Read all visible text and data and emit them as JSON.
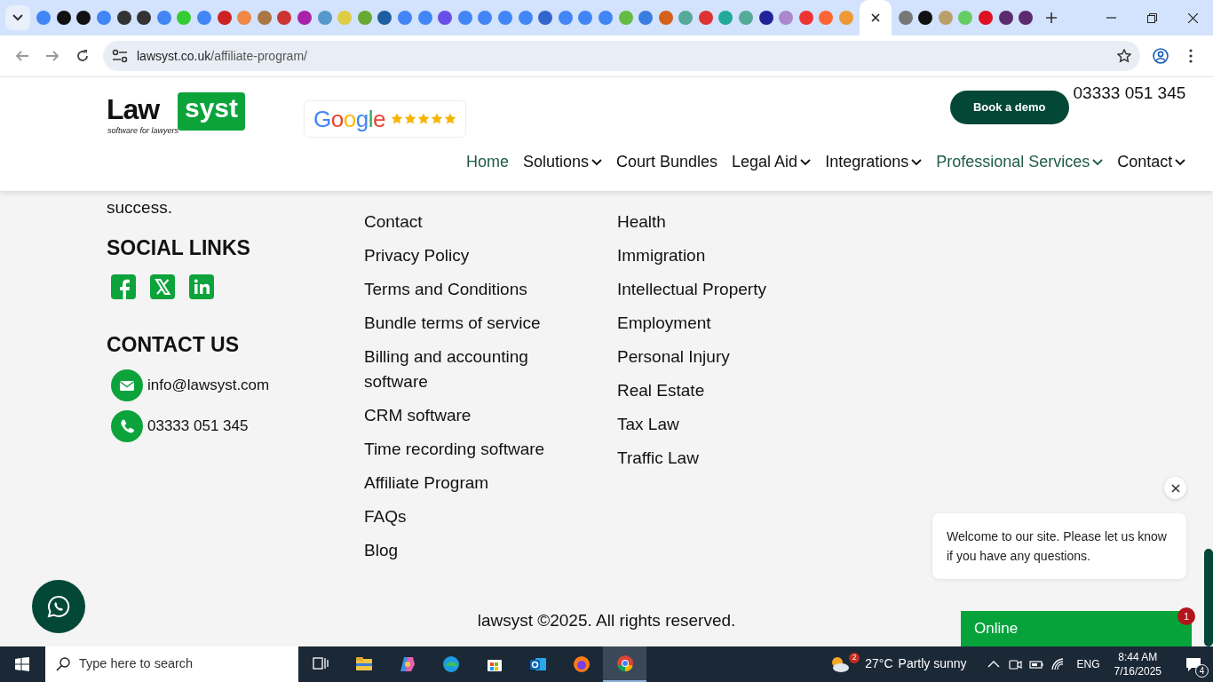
{
  "browser": {
    "tabs": [
      {
        "selected": false
      },
      {
        "selected": false
      },
      {
        "selected": false
      },
      {
        "selected": false
      },
      {
        "selected": false
      },
      {
        "selected": false
      },
      {
        "selected": false
      },
      {
        "selected": false
      },
      {
        "selected": false
      },
      {
        "selected": false
      },
      {
        "selected": false
      },
      {
        "selected": false
      },
      {
        "selected": false
      },
      {
        "selected": false
      },
      {
        "selected": false
      },
      {
        "selected": false
      },
      {
        "selected": false
      },
      {
        "selected": false
      },
      {
        "selected": false
      },
      {
        "selected": false
      },
      {
        "selected": false
      },
      {
        "selected": false
      },
      {
        "selected": false
      },
      {
        "selected": false
      },
      {
        "selected": false
      },
      {
        "selected": false
      },
      {
        "selected": false
      },
      {
        "selected": false
      },
      {
        "selected": false
      },
      {
        "selected": false
      },
      {
        "selected": false
      },
      {
        "selected": false
      },
      {
        "selected": false
      },
      {
        "selected": false
      },
      {
        "selected": false
      },
      {
        "selected": false
      },
      {
        "selected": false
      },
      {
        "selected": false
      },
      {
        "selected": false
      },
      {
        "selected": false
      },
      {
        "selected": false
      },
      {
        "selected": true
      },
      {
        "selected": false
      },
      {
        "selected": false
      },
      {
        "selected": false
      },
      {
        "selected": false
      },
      {
        "selected": false
      },
      {
        "selected": false
      },
      {
        "selected": false
      }
    ],
    "address": {
      "domain": "lawsyst.co.uk",
      "path": "/affiliate-program/"
    }
  },
  "header": {
    "logo": {
      "dark_part": "Law",
      "green_part": "syst",
      "tagline": "software for lawyers"
    },
    "rating": {
      "brand": "Google",
      "stars": 5
    },
    "cta": "Book a demo",
    "phone": "03333 051 345",
    "nav": [
      {
        "label": "Home",
        "selected": true,
        "dropdown": false
      },
      {
        "label": "Solutions",
        "selected": false,
        "dropdown": true
      },
      {
        "label": "Court Bundles",
        "selected": false,
        "dropdown": false
      },
      {
        "label": "Legal Aid",
        "selected": false,
        "dropdown": true
      },
      {
        "label": "Integrations",
        "selected": false,
        "dropdown": true
      },
      {
        "label": "Professional Services",
        "selected": true,
        "dropdown": true
      },
      {
        "label": "Contact",
        "selected": false,
        "dropdown": true
      }
    ]
  },
  "footer": {
    "about_tail": "success.",
    "social_heading": "SOCIAL LINKS",
    "social": [
      {
        "kind": "facebook"
      },
      {
        "kind": "x"
      },
      {
        "kind": "linkedin"
      }
    ],
    "contact_heading": "CONTACT US",
    "contacts": [
      {
        "kind": "email",
        "text": "info@lawsyst.com"
      },
      {
        "kind": "phone",
        "text": "03333 051 345"
      }
    ],
    "links": [
      "Contact",
      "Privacy Policy",
      "Terms and Conditions",
      "Bundle terms of service",
      "Billing and accounting software",
      "CRM software",
      "Time recording software",
      "Affiliate Program",
      "FAQs",
      "Blog"
    ],
    "practice_areas": [
      "Health",
      "Immigration",
      "Intellectual Property",
      "Employment",
      "Personal Injury",
      "Real Estate",
      "Tax Law",
      "Traffic Law"
    ],
    "copyright": "lawsyst ©2025. All rights reserved."
  },
  "chat": {
    "message": "Welcome to our site. Please let us know if you have any questions.",
    "status": "Online",
    "badge": "1"
  },
  "taskbar": {
    "search_placeholder": "Type here to search",
    "weather_badge": "2",
    "temperature": "27°C",
    "weather": "Partly sunny",
    "language": "ENG",
    "time": "8:44 AM",
    "date": "7/16/2025",
    "notifications": "4"
  }
}
